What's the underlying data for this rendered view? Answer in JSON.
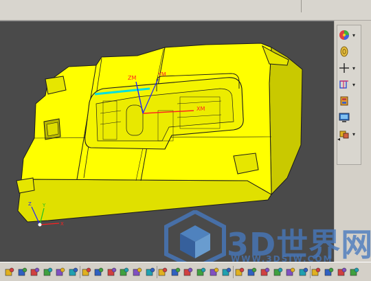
{
  "viewport": {
    "background": "#4a4a4a",
    "part_color": "#ffff00",
    "axes_local": {
      "x": "XM",
      "y": "YM",
      "z": "ZM"
    },
    "axes_global": {
      "x": "X",
      "y": "Y",
      "z": "Z"
    }
  },
  "right_toolbar": {
    "buttons": [
      {
        "icon": "render-mode-icon",
        "has_dropdown": true
      },
      {
        "icon": "rotate-view-icon",
        "has_dropdown": false
      },
      {
        "icon": "crosshair-icon",
        "has_dropdown": true
      },
      {
        "icon": "csys-icon",
        "has_dropdown": true
      },
      {
        "icon": "mold-wizard-icon",
        "has_dropdown": false
      },
      {
        "icon": "monitor-display-icon",
        "has_dropdown": false
      },
      {
        "icon": "component-tool-icon",
        "has_dropdown": true
      }
    ],
    "scroll_glyph": "◂",
    "dropdown_glyph": "▾"
  },
  "bottom_toolbar": {
    "icon_names": [
      "new-part-icon",
      "assembly-icon",
      "save-icon",
      "copy-icon",
      "measure-icon",
      "shade-icon",
      "add-component-icon",
      "add-existing-icon",
      "mate-icon",
      "reposition-icon",
      "replace-icon",
      "explode-icon",
      "split-icon",
      "move-icon",
      "wave-link-icon",
      "xy-plane-icon",
      "csys-display-icon",
      "view-tool-icon",
      "point-icon",
      "axis-icon",
      "orient-icon",
      "trim-icon",
      "extend-icon",
      "rotate-icon",
      "sketch-icon",
      "pattern-icon",
      "part-nav-icon",
      "layer-icon"
    ]
  },
  "watermark": {
    "title": "3D世界网",
    "url": "WWW.3DSJW.COM",
    "color": "#4678be"
  }
}
